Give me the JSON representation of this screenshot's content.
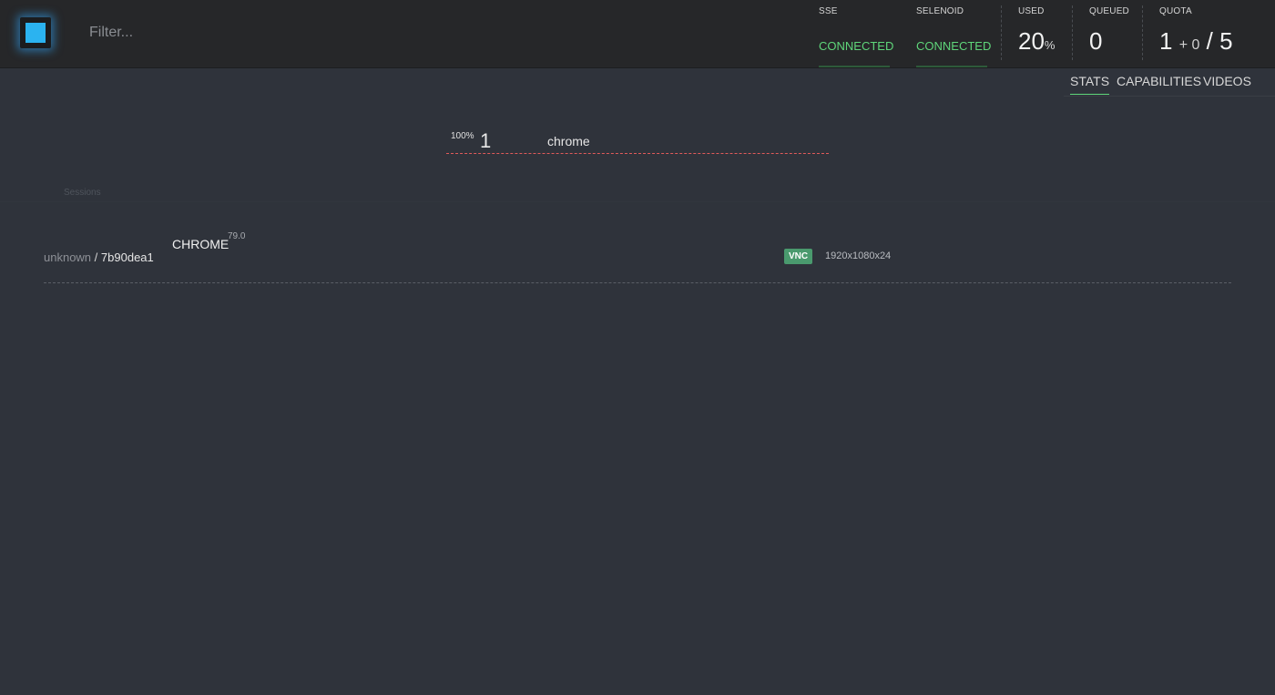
{
  "header": {
    "filter_placeholder": "Filter...",
    "sse": {
      "label": "SSE",
      "status": "CONNECTED"
    },
    "selenoid": {
      "label": "SELENOID",
      "status": "CONNECTED"
    },
    "used": {
      "label": "USED",
      "value": "20",
      "unit": "%"
    },
    "queued": {
      "label": "QUEUED",
      "value": "0"
    },
    "quota": {
      "label": "QUOTA",
      "value": "1",
      "pending": "+ 0",
      "total": "/ 5"
    }
  },
  "tabs": [
    {
      "label": "STATS",
      "active": true
    },
    {
      "label": "CAPABILITIES",
      "active": false
    },
    {
      "label": "VIDEOS",
      "active": false
    }
  ],
  "browser_usage": [
    {
      "percent": "100%",
      "count": "1",
      "browser": "chrome"
    }
  ],
  "sessions": {
    "label": "Sessions",
    "items": [
      {
        "user": "unknown",
        "separator": "/",
        "id": "7b90dea1",
        "browser": "CHROME",
        "version": "79.0",
        "vnc": "VNC",
        "resolution": "1920x1080x24"
      }
    ]
  },
  "colors": {
    "connected": "#5fd67a",
    "vnc_badge": "#4a9a6e",
    "logo_accent": "#2bb3f0",
    "usage_line": "#e05a5a"
  }
}
